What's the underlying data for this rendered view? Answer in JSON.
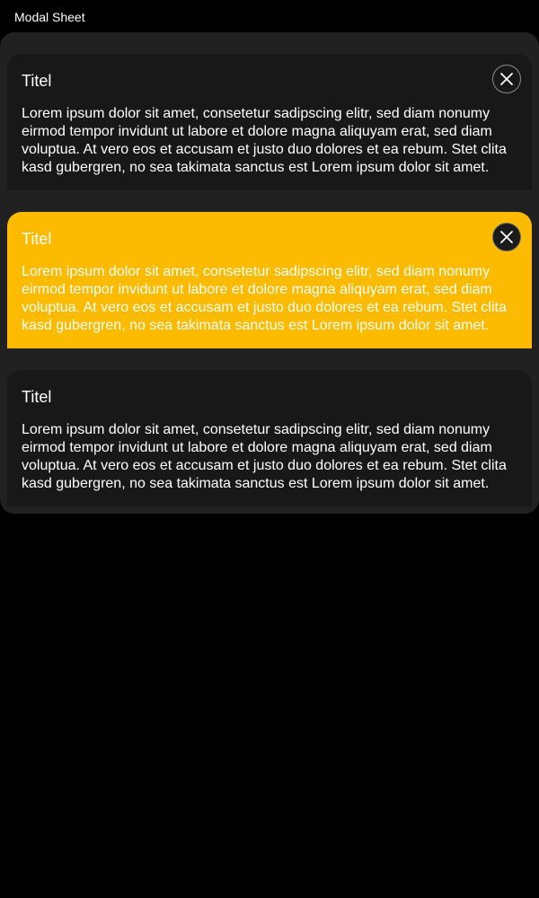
{
  "page": {
    "label": "Modal Sheet"
  },
  "sheets": [
    {
      "title": "Titel",
      "body": "Lorem ipsum dolor sit amet, consetetur sadipscing elitr, sed diam nonumy eirmod tempor invidunt ut labore et dolore magna aliquyam erat, sed diam voluptua. At vero eos et accusam et justo duo dolores et ea rebum. Stet clita kasd gubergren, no sea takimata sanctus est Lorem ipsum dolor sit amet.",
      "has_close": true,
      "close_icon": "close-icon",
      "variant": "default"
    },
    {
      "title": "Titel",
      "body": "Lorem ipsum dolor sit amet, consetetur sadipscing elitr, sed diam nonumy eirmod tempor invidunt ut labore et dolore magna aliquyam erat, sed diam voluptua. At vero eos et accusam et justo duo dolores et ea rebum. Stet clita kasd gubergren, no sea takimata sanctus est Lorem ipsum dolor sit amet.",
      "has_close": true,
      "close_icon": "close-icon",
      "variant": "highlight"
    },
    {
      "title": "Titel",
      "body": "Lorem ipsum dolor sit amet, consetetur sadipscing elitr, sed diam nonumy eirmod tempor invidunt ut labore et dolore magna aliquyam erat, sed diam voluptua. At vero eos et accusam et justo duo dolores et ea rebum. Stet clita kasd gubergren, no sea takimata sanctus est Lorem ipsum dolor sit amet.",
      "has_close": false,
      "variant": "default"
    }
  ],
  "colors": {
    "background": "#000000",
    "container": "#212121",
    "sheet": "#181818",
    "highlight": "#fdbb00",
    "text": "#ffffff"
  }
}
